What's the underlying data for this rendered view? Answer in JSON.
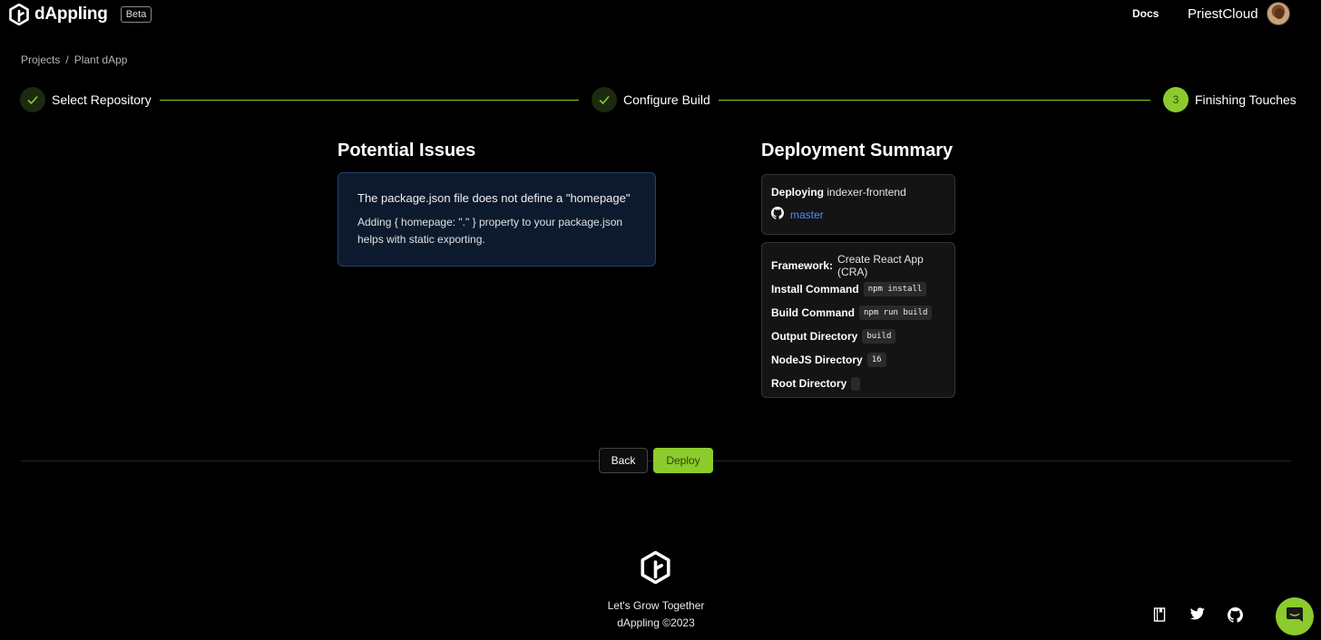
{
  "header": {
    "brand": "dAppling",
    "badge": "Beta",
    "docs": "Docs",
    "username": "PriestCloud"
  },
  "breadcrumb": {
    "items": [
      "Projects",
      "Plant dApp"
    ],
    "separator": "/"
  },
  "stepper": {
    "steps": [
      {
        "label": "Select Repository",
        "status": "done"
      },
      {
        "label": "Configure Build",
        "status": "done"
      },
      {
        "label": "Finishing Touches",
        "status": "active",
        "number": "3"
      }
    ]
  },
  "issues": {
    "title": "Potential Issues",
    "card": {
      "heading": "The package.json file does not define a \"homepage\"",
      "body": "Adding { homepage: \".\" } property to your package.json helps with static exporting."
    }
  },
  "summary": {
    "title": "Deployment Summary",
    "deploying_label": "Deploying",
    "deploying_value": "indexer-frontend",
    "branch": "master",
    "framework_label": "Framework:",
    "framework_value": "Create React App (CRA)",
    "rows": [
      {
        "label": "Install Command",
        "value": "npm install"
      },
      {
        "label": "Build Command",
        "value": "npm run build"
      },
      {
        "label": "Output Directory",
        "value": "build"
      },
      {
        "label": "NodeJS Directory",
        "value": "16"
      },
      {
        "label": "Root Directory",
        "value": ""
      }
    ]
  },
  "actions": {
    "back": "Back",
    "deploy": "Deploy"
  },
  "footer": {
    "tagline": "Let's Grow Together",
    "copyright": "dAppling ©2023",
    "icons": [
      "book-icon",
      "twitter-icon",
      "github-icon",
      "chat-icon"
    ]
  },
  "colors": {
    "accent": "#8ccb2c",
    "link": "#4d8dff",
    "issue_bg": "#0d1a2e",
    "card_bg": "#141414"
  }
}
